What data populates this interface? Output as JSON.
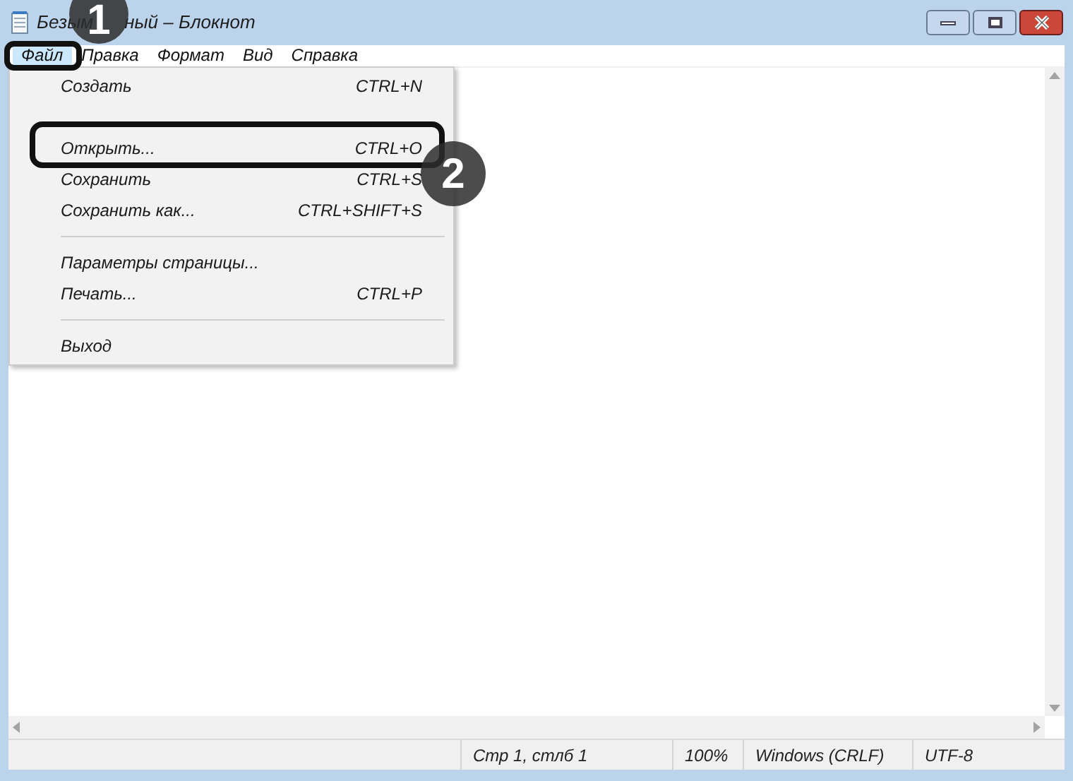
{
  "window": {
    "title_parts": [
      "Безым",
      "ный – Блокнот"
    ]
  },
  "menu_bar": [
    {
      "label": "Файл",
      "selected": true
    },
    {
      "label": "Правка",
      "selected": false
    },
    {
      "label": "Формат",
      "selected": false
    },
    {
      "label": "Вид",
      "selected": false
    },
    {
      "label": "Справка",
      "selected": false
    }
  ],
  "file_menu": [
    {
      "kind": "item",
      "label": "Создать",
      "shortcut": "CTRL+N"
    },
    {
      "kind": "covered"
    },
    {
      "kind": "item",
      "label": "Открыть...",
      "shortcut": "CTRL+O"
    },
    {
      "kind": "item",
      "label": "Сохранить",
      "shortcut": "CTRL+S"
    },
    {
      "kind": "item",
      "label": "Сохранить как...",
      "shortcut": "CTRL+SHIFT+S"
    },
    {
      "kind": "separator"
    },
    {
      "kind": "item",
      "label": "Параметры страницы..."
    },
    {
      "kind": "item",
      "label": "Печать...",
      "shortcut": "CTRL+P"
    },
    {
      "kind": "separator"
    },
    {
      "kind": "item",
      "label": "Выход"
    }
  ],
  "callouts": [
    {
      "number": "1"
    },
    {
      "number": "2"
    }
  ],
  "status_bar": [
    "Стр 1, стлб 1",
    "100%",
    "Windows (CRLF)",
    "UTF-8"
  ]
}
